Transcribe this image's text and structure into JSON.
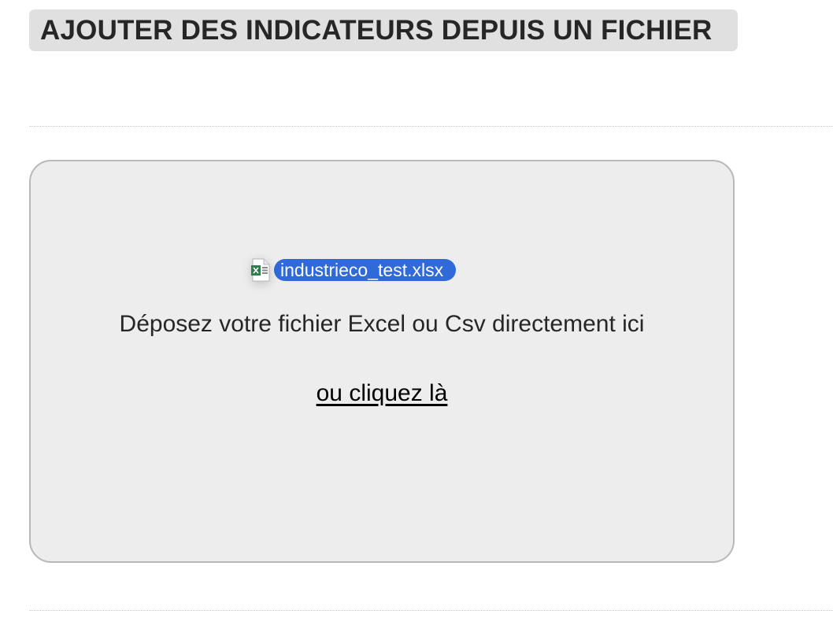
{
  "header": {
    "title": "AJOUTER DES INDICATEURS DEPUIS UN FICHIER"
  },
  "dropzone": {
    "dragged_file": {
      "name": "industrieco_test.xlsx",
      "icon": "excel-file-icon"
    },
    "instruction": "Déposez votre fichier Excel ou Csv directement ici",
    "click_link": "ou cliquez là"
  },
  "colors": {
    "title_background": "#e0e0e0",
    "dropzone_background": "#ededed",
    "dropzone_border": "#b8b8b8",
    "file_pill": "#2f6ad8",
    "excel_green": "#2e7d4f"
  }
}
